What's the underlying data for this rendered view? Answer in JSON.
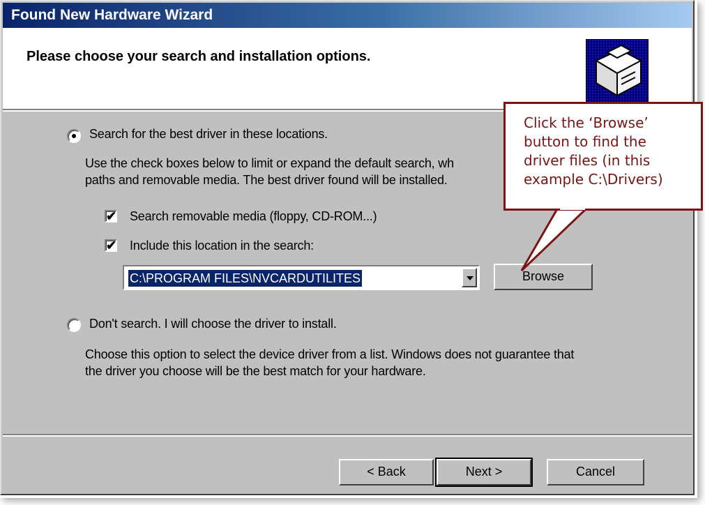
{
  "window": {
    "title": "Found New Hardware Wizard"
  },
  "header": {
    "title": "Please choose your search and installation options.",
    "icon": "hardware-install-icon"
  },
  "options": {
    "search_best": {
      "label": "Search for the best driver in these locations.",
      "selected": true,
      "description": "Use the check boxes below to limit or expand the default search, wh",
      "description_line2": "paths and removable media. The best driver found will be installed."
    },
    "removable_media": {
      "label": "Search removable media (floppy, CD-ROM...)",
      "checked": true
    },
    "include_location": {
      "label": "Include this location in the search:",
      "checked": true
    },
    "location": {
      "value": "C:\\PROGRAM FILES\\NVCARDUTILITES"
    },
    "browse_label": "Browse",
    "dont_search": {
      "label": "Don't search. I will choose the driver to install.",
      "selected": false,
      "description_line1": "Choose this option to select the device driver from a list.  Windows does not guarantee that",
      "description_line2": "the driver you choose will be the best match for your hardware."
    }
  },
  "footer": {
    "back_label": "< Back",
    "next_label": "Next >",
    "cancel_label": "Cancel"
  },
  "callout": {
    "line1": "Click the ‘Browse’",
    "line2": "button to find the",
    "line3": "driver files (in this",
    "line4": "example C:\\Drivers)",
    "color": "#7b1515"
  }
}
